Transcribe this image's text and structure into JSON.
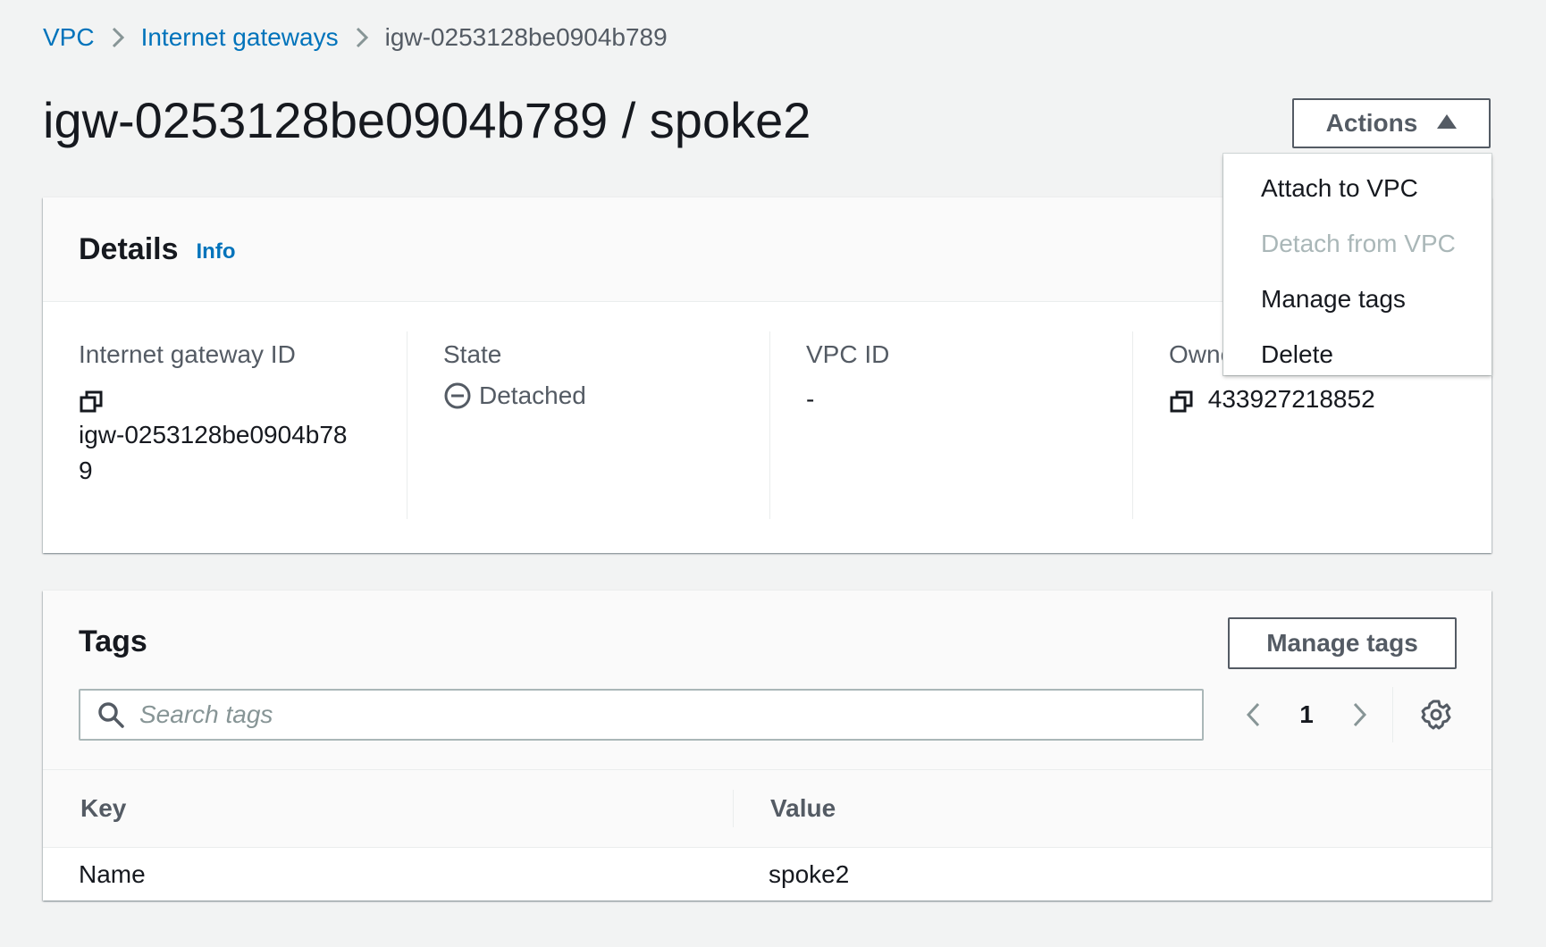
{
  "breadcrumb": {
    "items": [
      {
        "label": "VPC"
      },
      {
        "label": "Internet gateways"
      }
    ],
    "current": "igw-0253128be0904b789"
  },
  "page": {
    "title": "igw-0253128be0904b789 / spoke2"
  },
  "actions": {
    "label": "Actions",
    "menu": [
      {
        "label": "Attach to VPC",
        "enabled": true
      },
      {
        "label": "Detach from VPC",
        "enabled": false
      },
      {
        "label": "Manage tags",
        "enabled": true
      },
      {
        "label": "Delete",
        "enabled": true
      }
    ]
  },
  "details": {
    "title": "Details",
    "info_label": "Info",
    "fields": {
      "gateway_id": {
        "label": "Internet gateway ID",
        "value_line1": "igw-0253128be0904b78",
        "value_line2": "9"
      },
      "state": {
        "label": "State",
        "value": "Detached"
      },
      "vpc_id": {
        "label": "VPC ID",
        "value": "-"
      },
      "owner": {
        "label": "Owner",
        "value": "433927218852"
      }
    }
  },
  "tags": {
    "title": "Tags",
    "manage_label": "Manage tags",
    "search_placeholder": "Search tags",
    "page_number": "1",
    "columns": {
      "key": "Key",
      "value": "Value"
    },
    "rows": [
      {
        "key": "Name",
        "value": "spoke2"
      }
    ]
  },
  "colors": {
    "link": "#0073bb",
    "background": "#f2f3f3",
    "disabled": "#aab7b8"
  }
}
